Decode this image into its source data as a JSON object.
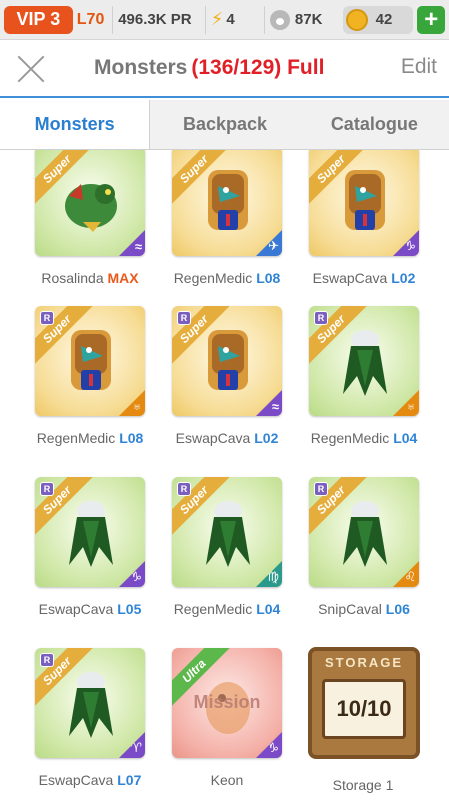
{
  "topbar": {
    "vip": "VIP 3",
    "level": "L70",
    "power": "496.3K PR",
    "energy": "4",
    "paws": "87K",
    "coins": "42",
    "add": "+"
  },
  "header": {
    "title": "Monsters",
    "count": "(136/129) Full",
    "edit": "Edit"
  },
  "tabs": [
    "Monsters",
    "Backpack",
    "Catalogue"
  ],
  "monsters": [
    {
      "name": "Rosalinda",
      "level": "MAX",
      "rarity": "Super",
      "bg": "green",
      "element": "≈",
      "element_color": "purple",
      "art": "dragon",
      "r_badge": false
    },
    {
      "name": "RegenMedic",
      "level": "L08",
      "rarity": "Super",
      "bg": "gold",
      "element": "✈",
      "element_color": "blue",
      "art": "bird",
      "r_badge": false
    },
    {
      "name": "EswapCava",
      "level": "L02",
      "rarity": "Super",
      "bg": "gold",
      "element": "♑",
      "element_color": "purple",
      "art": "bird",
      "r_badge": false
    },
    {
      "name": "RegenMedic",
      "level": "L08",
      "rarity": "Super",
      "bg": "gold",
      "element": "♅",
      "element_color": "orange",
      "art": "bird",
      "r_badge": true
    },
    {
      "name": "EswapCava",
      "level": "L02",
      "rarity": "Super",
      "bg": "gold",
      "element": "≈",
      "element_color": "purple",
      "art": "bird",
      "r_badge": true
    },
    {
      "name": "RegenMedic",
      "level": "L04",
      "rarity": "Super",
      "bg": "green",
      "element": "♅",
      "element_color": "orange",
      "art": "leaf",
      "r_badge": true
    },
    {
      "name": "EswapCava",
      "level": "L05",
      "rarity": "Super",
      "bg": "green",
      "element": "♑",
      "element_color": "purple",
      "art": "leaf",
      "r_badge": true
    },
    {
      "name": "RegenMedic",
      "level": "L04",
      "rarity": "Super",
      "bg": "green",
      "element": "♍",
      "element_color": "teal",
      "art": "leaf",
      "r_badge": true
    },
    {
      "name": "SnipCaval",
      "level": "L06",
      "rarity": "Super",
      "bg": "green",
      "element": "♌",
      "element_color": "orange",
      "art": "leaf",
      "r_badge": true
    },
    {
      "name": "EswapCava",
      "level": "L07",
      "rarity": "Super",
      "bg": "green",
      "element": "♈",
      "element_color": "purple",
      "art": "leaf",
      "r_badge": true
    },
    {
      "name": "Keon",
      "level": "",
      "rarity": "Ultra",
      "bg": "red",
      "element": "♑",
      "element_color": "purple",
      "art": "egg",
      "overlay": "Mission",
      "r_badge": false
    }
  ],
  "storage": {
    "label": "STORAGE",
    "capacity": "10/10",
    "name": "Storage 1"
  }
}
